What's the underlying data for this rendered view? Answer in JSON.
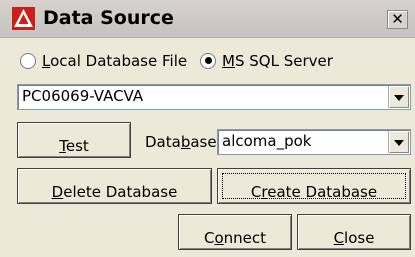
{
  "window": {
    "title": "Data Source",
    "close_glyph": "✕"
  },
  "source": {
    "options": [
      {
        "prefix": "",
        "underlined": "L",
        "suffix": "ocal Database File",
        "selected": false
      },
      {
        "prefix": "",
        "underlined": "M",
        "suffix": "S SQL Server",
        "selected": true
      }
    ],
    "server": "PC06069-VACVA"
  },
  "database": {
    "test_button": {
      "prefix": "",
      "underlined": "T",
      "suffix": "est"
    },
    "label": {
      "prefix": "Data",
      "underlined": "b",
      "suffix": "ase"
    },
    "selected": "alcoma_pok"
  },
  "actions": {
    "delete": {
      "prefix": "",
      "underlined": "D",
      "suffix": "elete Database"
    },
    "create": {
      "prefix": "C",
      "underlined": "r",
      "suffix": "eate Database"
    },
    "connect": {
      "prefix": "C",
      "underlined": "o",
      "suffix": "nnect"
    },
    "close": {
      "prefix": "",
      "underlined": "C",
      "suffix": "lose"
    }
  },
  "colors": {
    "icon_red": "#cc1f1a",
    "background": "#ece9d8"
  }
}
